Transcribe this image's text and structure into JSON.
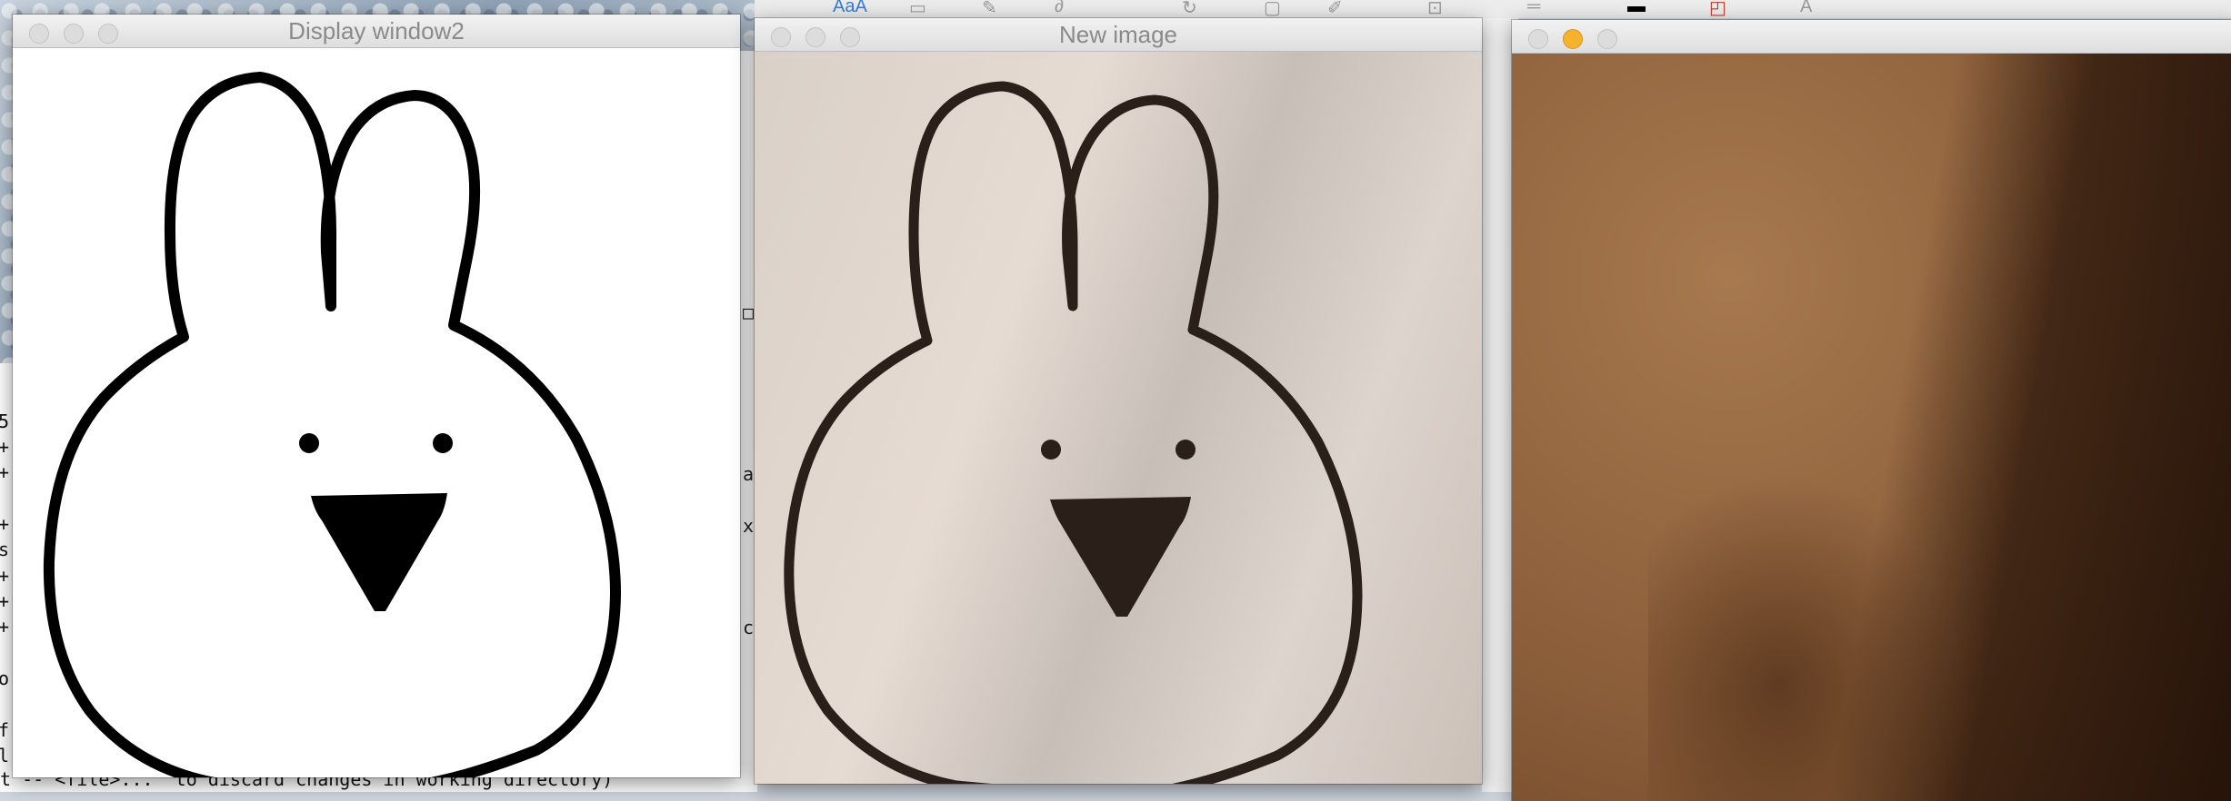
{
  "windows": {
    "display": {
      "title": "Display window2"
    },
    "new_image": {
      "title": "New image"
    },
    "video": {
      "title": ""
    }
  },
  "terminal": {
    "line_fragments": [
      "5",
      "+",
      "+",
      "+",
      "s",
      "+",
      "+",
      "+",
      "o:",
      "f",
      "l"
    ],
    "bottom_line": "t -- <file>...\" to discard changes in working directory)"
  },
  "background_window": {
    "fragments": [
      "□",
      "a",
      "x",
      "c"
    ]
  },
  "toolbar": {
    "aa_label": "AaA",
    "item_a": "A"
  },
  "colors": {
    "outline": "#000000",
    "photo_outline": "#2a1f19",
    "traffic_yellow": "#f6b12d"
  }
}
